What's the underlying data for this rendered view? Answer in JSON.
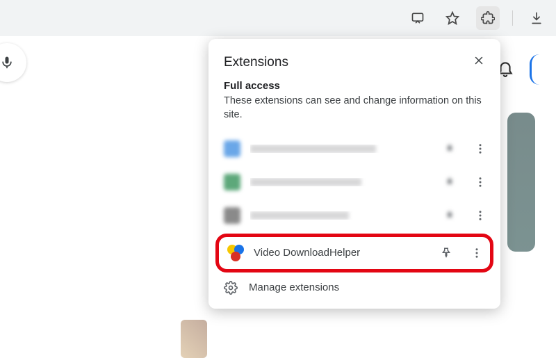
{
  "toolbar": {
    "cast": "cast-to-device",
    "star": "bookmark-star",
    "extensions": "extensions-puzzle",
    "download": "download"
  },
  "page": {
    "mic": "voice-search"
  },
  "right": {
    "bell": "notifications"
  },
  "popup": {
    "title": "Extensions",
    "close": "Close",
    "section_heading": "Full access",
    "section_desc": "These extensions can see and change information on this site.",
    "items": [
      {
        "name": "(blurred extension 1)",
        "blurred": true
      },
      {
        "name": "(blurred extension 2)",
        "blurred": true
      },
      {
        "name": "(blurred extension 3)",
        "blurred": true
      },
      {
        "name": "Video DownloadHelper",
        "blurred": false,
        "highlighted": true
      }
    ],
    "manage_label": "Manage extensions"
  }
}
